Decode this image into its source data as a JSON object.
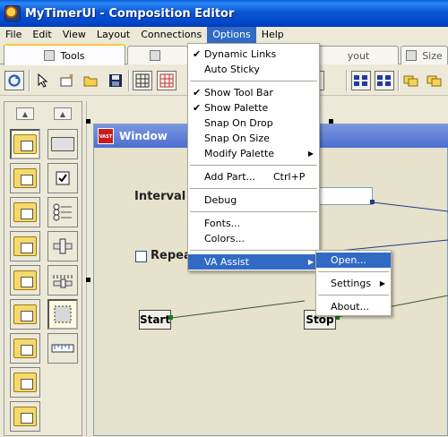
{
  "window": {
    "title": "MyTimerUI - Composition Editor"
  },
  "menubar": [
    "File",
    "Edit",
    "View",
    "Layout",
    "Connections",
    "Options",
    "Help"
  ],
  "tabs": [
    {
      "label": "Tools"
    },
    {
      "label": ""
    },
    {
      "label": "yout"
    },
    {
      "label": "Size"
    }
  ],
  "options_menu": {
    "items": [
      {
        "label": "Dynamic Links",
        "checked": true
      },
      {
        "label": "Auto Sticky",
        "checked": false
      },
      {
        "label": "Show Tool Bar",
        "checked": true
      },
      {
        "label": "Show Palette",
        "checked": true
      },
      {
        "label": "Snap On Drop",
        "checked": false
      },
      {
        "label": "Snap On Size",
        "checked": false
      },
      {
        "label": "Modify Palette",
        "submenu": true
      },
      {
        "label": "Add Part...",
        "shortcut": "Ctrl+P"
      },
      {
        "label": "Debug"
      },
      {
        "label": "Fonts..."
      },
      {
        "label": "Colors..."
      },
      {
        "label": "VA Assist",
        "submenu": true,
        "highlighted": true
      }
    ],
    "check_glyph": "✔",
    "arrow_glyph": "▶"
  },
  "va_assist_menu": {
    "items": [
      {
        "label": "Open...",
        "highlighted": true
      },
      {
        "label": "Settings",
        "submenu": true
      },
      {
        "label": "About..."
      }
    ]
  },
  "visual_window": {
    "title": "Window",
    "icon_text": "VAST",
    "interval_label": "Interval",
    "repeat_label": "Repea",
    "start_label": "Start",
    "stop_label": "Stop"
  },
  "colors": {
    "titlebar": "#0b56d5",
    "menu_highlight": "#316ac5",
    "connection_line": "#3a5a2a"
  },
  "icons": {
    "app": "timer-app-icon",
    "palette_up": "▲",
    "visual_window": "vast-icon"
  }
}
